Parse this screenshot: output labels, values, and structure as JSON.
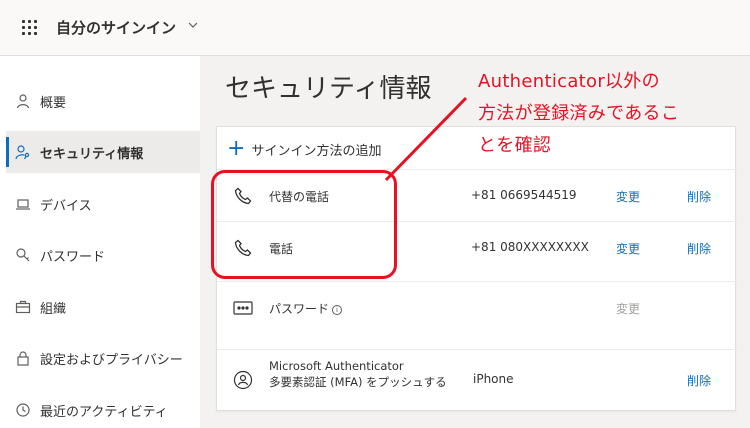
{
  "header": {
    "app_title": "自分のサインイン",
    "icons": {
      "waffle": "waffle-icon",
      "chevron": "chevron-down-icon"
    }
  },
  "sidebar": {
    "items": [
      {
        "label": "概要",
        "icon": "person-icon",
        "active": false
      },
      {
        "label": "セキュリティ情報",
        "icon": "person-key-icon",
        "active": true
      },
      {
        "label": "デバイス",
        "icon": "laptop-icon",
        "active": false
      },
      {
        "label": "パスワード",
        "icon": "key-icon",
        "active": false
      },
      {
        "label": "組織",
        "icon": "briefcase-icon",
        "active": false
      },
      {
        "label": "設定およびプライバシー",
        "icon": "lock-icon",
        "active": false
      },
      {
        "label": "最近のアクティビティ",
        "icon": "history-icon",
        "active": false
      }
    ]
  },
  "main": {
    "title": "セキュリティ情報",
    "add_method_label": "サインイン方法の追加",
    "methods": [
      {
        "name": "代替の電話",
        "value": "+81 0669544519",
        "change": "変更",
        "delete": "削除",
        "icon": "phone-icon"
      },
      {
        "name": "電話",
        "value": "+81 080XXXXXXXX",
        "change": "変更",
        "delete": "削除",
        "icon": "phone-icon"
      },
      {
        "name": "パスワード",
        "value": "",
        "change": "変更",
        "delete": "",
        "icon": "password-dots-icon"
      },
      {
        "name": "Microsoft Authenticator",
        "subtitle": "多要素認証 (MFA) をプッシュする",
        "value": "iPhone",
        "change": "",
        "delete": "削除",
        "icon": "authenticator-icon"
      }
    ]
  },
  "annotation": {
    "line1": "Authenticator以外の",
    "line2": "方法が登録済みであるこ",
    "line3": "とを確認",
    "color": "#e81123"
  },
  "colors": {
    "accent": "#0f6cbd",
    "annotation": "#e81123"
  }
}
